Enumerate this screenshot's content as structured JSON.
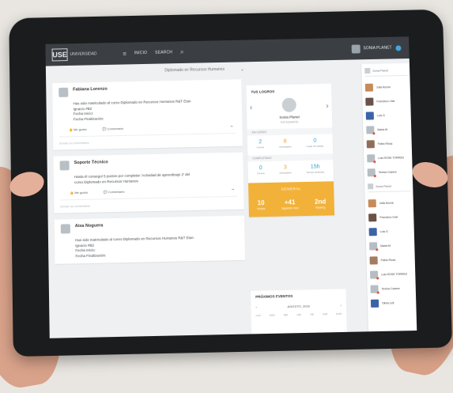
{
  "topbar": {
    "logo_mark": "USE",
    "logo_text": "UNIVERSIDAD",
    "nav_home": "INICIO",
    "nav_link": "SEARCH",
    "user_name": "SONIA PLANET"
  },
  "filter": {
    "selected": "Diplomado en Recursos Humanos"
  },
  "posts": [
    {
      "name": "Fabiana Lorenzo",
      "body": [
        "Has sido matriculado al curso Diplomado en Recursos Humanos R&T Etan",
        "Ignacio #B2",
        "Fecha Inicio:",
        "Fecha Finalización:"
      ],
      "like": "Me gusta",
      "comment": "Comentario",
      "write_comment": "Enviar su comentario"
    },
    {
      "name": "Soporte Técnico",
      "body": [
        "Hasta él conseguí 5 puntos por completar 'Actividad de aprendizaje 2' del",
        "curso Diplomado en Recursos Humanos"
      ],
      "like": "Me gusta",
      "comment": "Comentario",
      "write_comment": "Enviar su comentario"
    },
    {
      "name": "Aixa Noguera",
      "body": [
        "Has sido matriculado al curso Diplomado en Recursos Humanos R&T Etan",
        "Ignacio #B2",
        "Fecha Inicio:",
        "Fecha Finalización:"
      ]
    }
  ],
  "stats": {
    "title": "TUS LOGROS",
    "profile_name": "Sonia Planet",
    "profile_role": "ESTUDIANTE",
    "section1": "EN CURSO",
    "section2": "COMPLETADO",
    "row1": [
      {
        "num": "2",
        "lbl": "Cursos"
      },
      {
        "num": "8",
        "lbl": "Actividades"
      },
      {
        "num": "0",
        "lbl": "Lugar de trabajo"
      }
    ],
    "row2": [
      {
        "num": "0",
        "lbl": "Cursos"
      },
      {
        "num": "3",
        "lbl": "Actividades"
      },
      {
        "num": "15h",
        "lbl": "Tiempo dedicado"
      }
    ],
    "rank_title": "GENERAL",
    "rank": [
      {
        "num": "10",
        "lbl": "Puntos"
      },
      {
        "num": "+41",
        "lbl": "Siguiente nivel"
      },
      {
        "num": "2nd",
        "lbl": "Ranking"
      }
    ]
  },
  "events": {
    "title": "PRÓXIMOS EVENTOS",
    "month": "AGOSTO, 2016",
    "days": [
      "LUN",
      "MAR",
      "MIE",
      "JUE",
      "VIE",
      "SAB",
      "DOM"
    ]
  },
  "people": {
    "search1": "Sonia Planet",
    "list1": [
      "Julia Acuna",
      "Francisco Lbar",
      "Luis G",
      "Marta M",
      "Pablo Rivas",
      "Luis ROSE TORRES",
      "Teresa Casera"
    ],
    "search2": "Sonia Planet",
    "list2": [
      "Julia Acuna",
      "Francisco Lbar",
      "Luis G",
      "Marta M",
      "Pablo Rivas",
      "Luis ROSE TORRES",
      "Teresa Casera",
      "Olivia Lidi"
    ]
  }
}
